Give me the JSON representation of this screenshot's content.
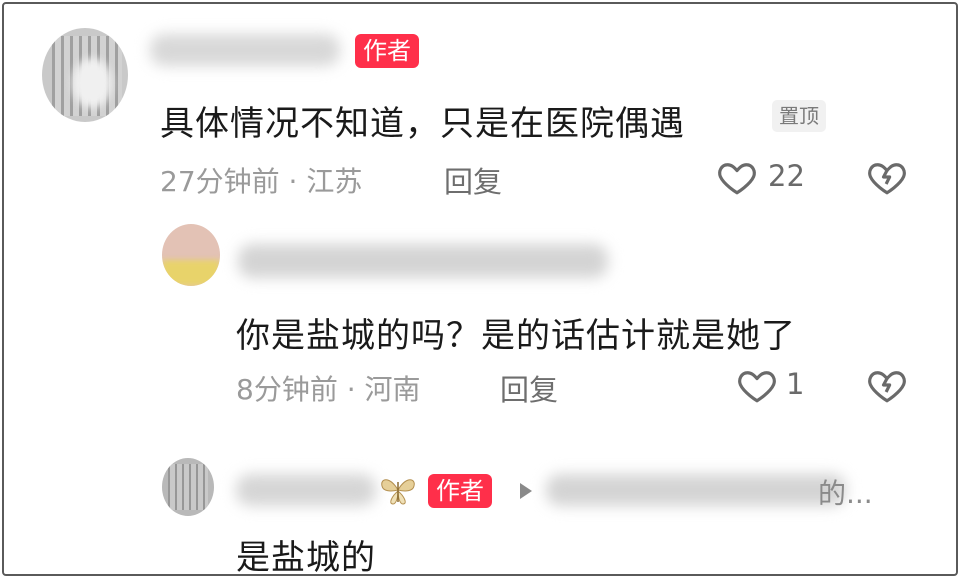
{
  "comments": [
    {
      "badge": "作者",
      "text": "具体情况不知道，只是在医院偶遇",
      "pin": "置顶",
      "meta": "27分钟前 · 江苏",
      "reply": "回复",
      "likes": "22"
    },
    {
      "text": "你是盐城的吗？是的话估计就是她了",
      "meta": "8分钟前 · 河南",
      "reply": "回复",
      "likes": "1"
    },
    {
      "badge": "作者",
      "reply_to_tail": "的...",
      "text": "是盐城的"
    }
  ],
  "icons": [
    "like-heart-icon",
    "dislike-broken-heart-icon",
    "butterfly-icon",
    "reply-arrow-icon"
  ],
  "colors": {
    "badge": "#ff2f4a",
    "text": "#1a1a1a",
    "meta": "#9a9a9a",
    "icon": "#6a6a6a"
  }
}
